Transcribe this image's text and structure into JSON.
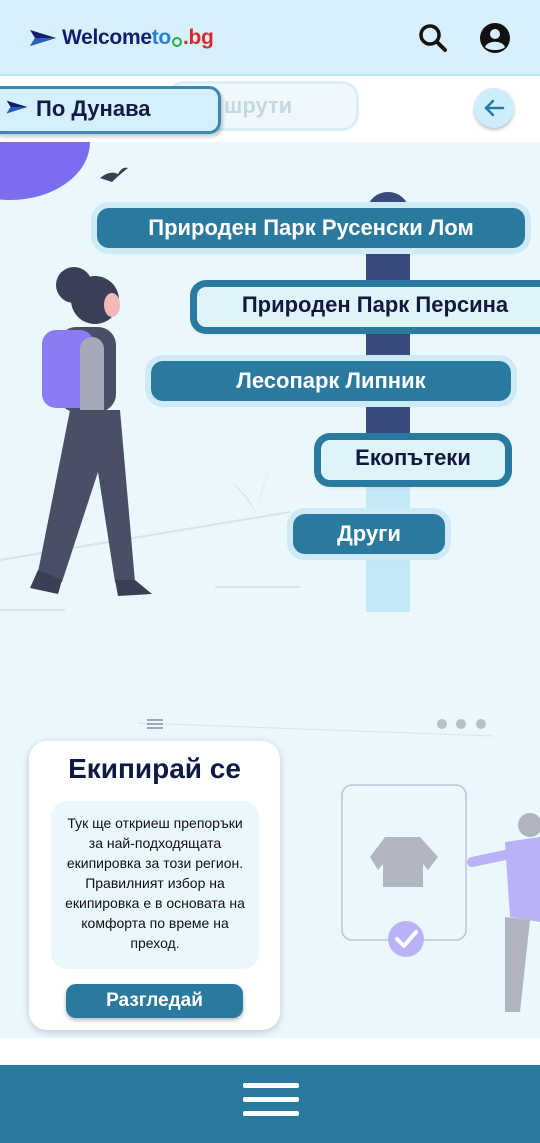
{
  "header": {
    "logo": {
      "welcome": "Welcome",
      "to": "to",
      "bg": ".bg"
    },
    "icons": [
      "search-icon",
      "account-icon"
    ]
  },
  "filters": {
    "active_label": "По Дунава",
    "ghost_label": "шрути"
  },
  "destinations": [
    {
      "label": "Природен Парк Русенски Лом"
    },
    {
      "label": "Природен Парк Персина"
    },
    {
      "label": "Лесопарк Липник"
    },
    {
      "label": "Екопътеки"
    },
    {
      "label": "Други"
    }
  ],
  "equip_card": {
    "title": "Екипирай се",
    "description": "Тук ще откриеш препоръки за най-подходящата екипировка за този регион. Правилният избор на екипировка е в основата на комфорта по време на преход.",
    "button_label": "Разгледай"
  },
  "colors": {
    "primary": "#2a7aa0",
    "header_bg": "#d7f0fb",
    "scene_bg": "#eaf7fd",
    "dark_text": "#0e1a46",
    "accent_purple": "#7b6cf0"
  }
}
